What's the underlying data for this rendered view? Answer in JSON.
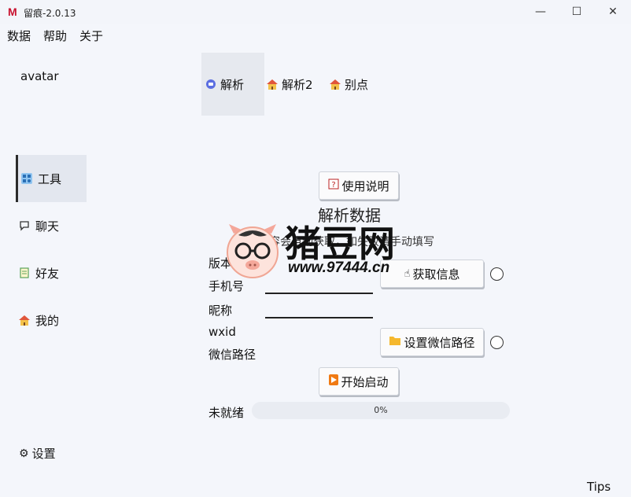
{
  "window": {
    "logo": "M",
    "title": "留痕-2.0.13",
    "minimize": "—",
    "maximize": "☐",
    "close": "✕"
  },
  "menu": [
    "数据",
    "帮助",
    "关于"
  ],
  "sidebar": {
    "avatar": "avatar",
    "items": [
      {
        "label": "工具",
        "icon": "tools-icon"
      },
      {
        "label": "聊天",
        "icon": "chat-icon"
      },
      {
        "label": "好友",
        "icon": "contacts-icon"
      },
      {
        "label": "我的",
        "icon": "home-icon"
      }
    ],
    "settings": "设置"
  },
  "tabs": [
    {
      "label": "解析",
      "icon": "parse-icon"
    },
    {
      "label": "解析2",
      "icon": "house-icon"
    },
    {
      "label": "别点",
      "icon": "house-icon"
    }
  ],
  "main": {
    "help_button": "使用说明",
    "heading": "解析数据",
    "notice": "以下内容会自动获取，如失败请手动填写",
    "fields": {
      "version": "版本",
      "phone": "手机号",
      "nickname": "昵称",
      "wxid": "wxid",
      "wechat_path": "微信路径"
    },
    "get_info_button": "获取信息",
    "set_path_button": "设置微信路径",
    "start_button": "开始启动",
    "status": "未就绪",
    "progress_text": "0%",
    "progress_value": 0
  },
  "tips": "Tips",
  "watermark": {
    "brand": "猪豆网",
    "url": "www.97444.cn"
  },
  "colors": {
    "accent": "#4a8af4",
    "logo": "#c8102e",
    "start_icon": "#f07a13",
    "folder_icon": "#f5b82e"
  }
}
